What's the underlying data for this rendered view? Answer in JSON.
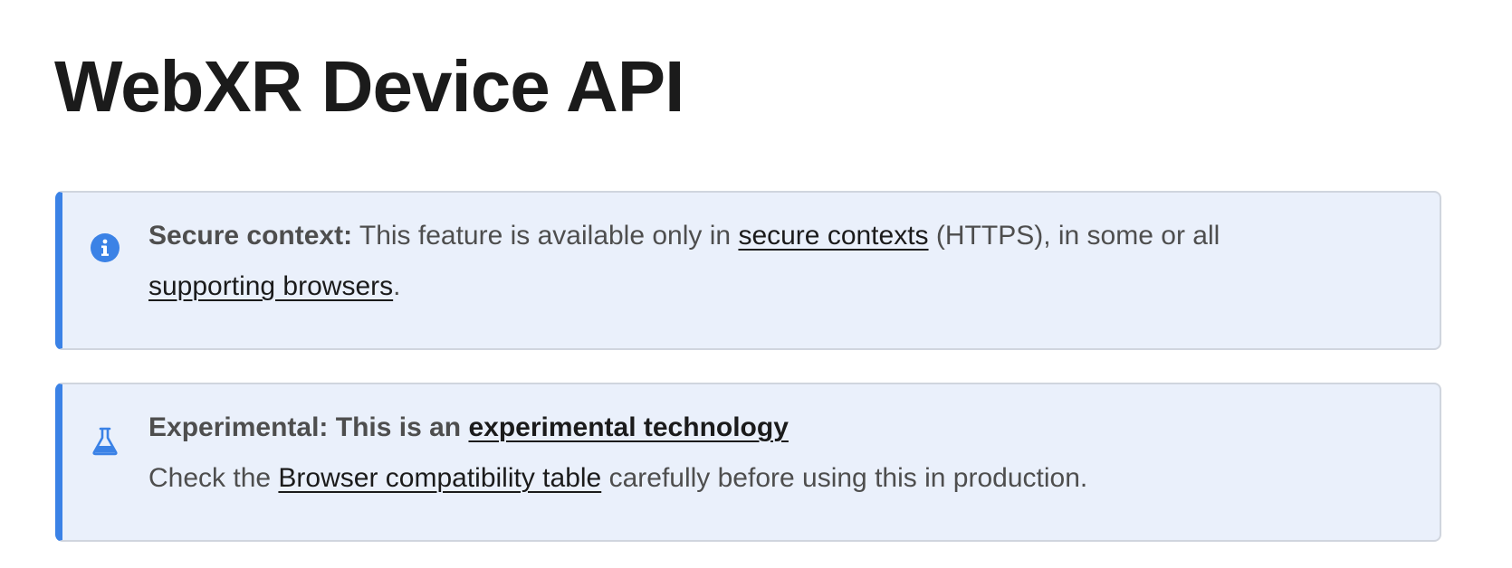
{
  "page": {
    "title": "WebXR Device API"
  },
  "secure_notice": {
    "icon": "info-icon",
    "label": "Secure context:",
    "text_before": "This feature is available only in",
    "link1": "secure contexts",
    "text_middle": "(HTTPS), in some or all",
    "link2": "supporting browsers",
    "text_end": "."
  },
  "experimental_notice": {
    "icon": "flask-icon",
    "label": "Experimental:",
    "label_rest": "This is an",
    "link1": "experimental technology",
    "line2_before": "Check the",
    "link2": "Browser compatibility table",
    "line2_after": "carefully before using this in production."
  },
  "colors": {
    "accent": "#3b82e6",
    "notice_bg": "#eaf0fb",
    "notice_border": "#d0d5de",
    "text": "#1b1b1b",
    "muted_text": "#4e4e4e"
  }
}
